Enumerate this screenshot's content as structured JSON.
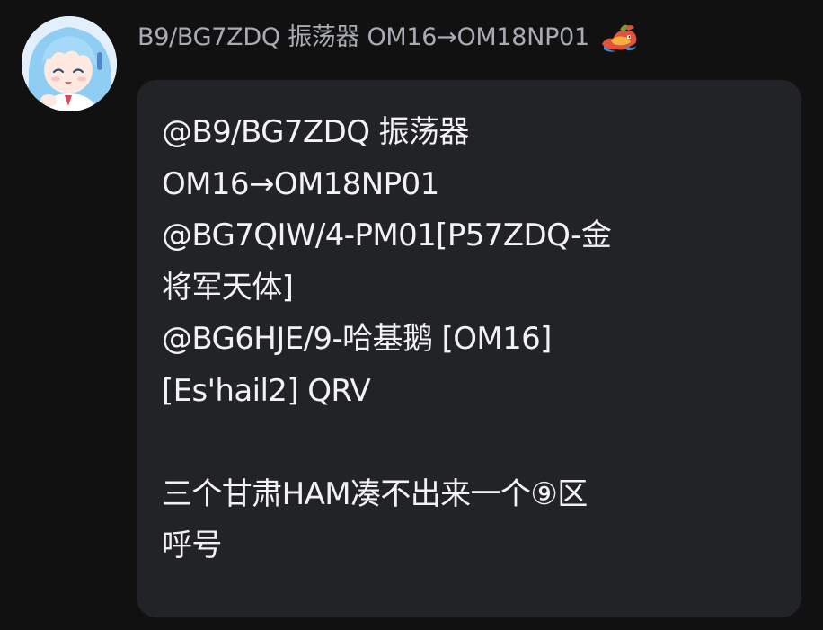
{
  "message": {
    "sender_name": "B9/BG7ZDQ 振荡器 OM16→OM18NP01",
    "avatar_icon": "anime-avatar",
    "badge_icon": "dragon-badge-icon",
    "text": "@B9/BG7ZDQ 振荡器\nOM16→OM18NP01\n@BG7QIW/4-PM01[P57ZDQ-金\n将军天体]\n@BG6HJE/9-哈基鹅 [OM16]\n[Es'hail2] QRV\n\n三个甘肃HAM凑不出来一个⑨区\n呼号"
  },
  "colors": {
    "background": "#111111",
    "bubble": "#222327",
    "sender_text": "#a9acb3",
    "message_text": "#f2f2f2"
  }
}
